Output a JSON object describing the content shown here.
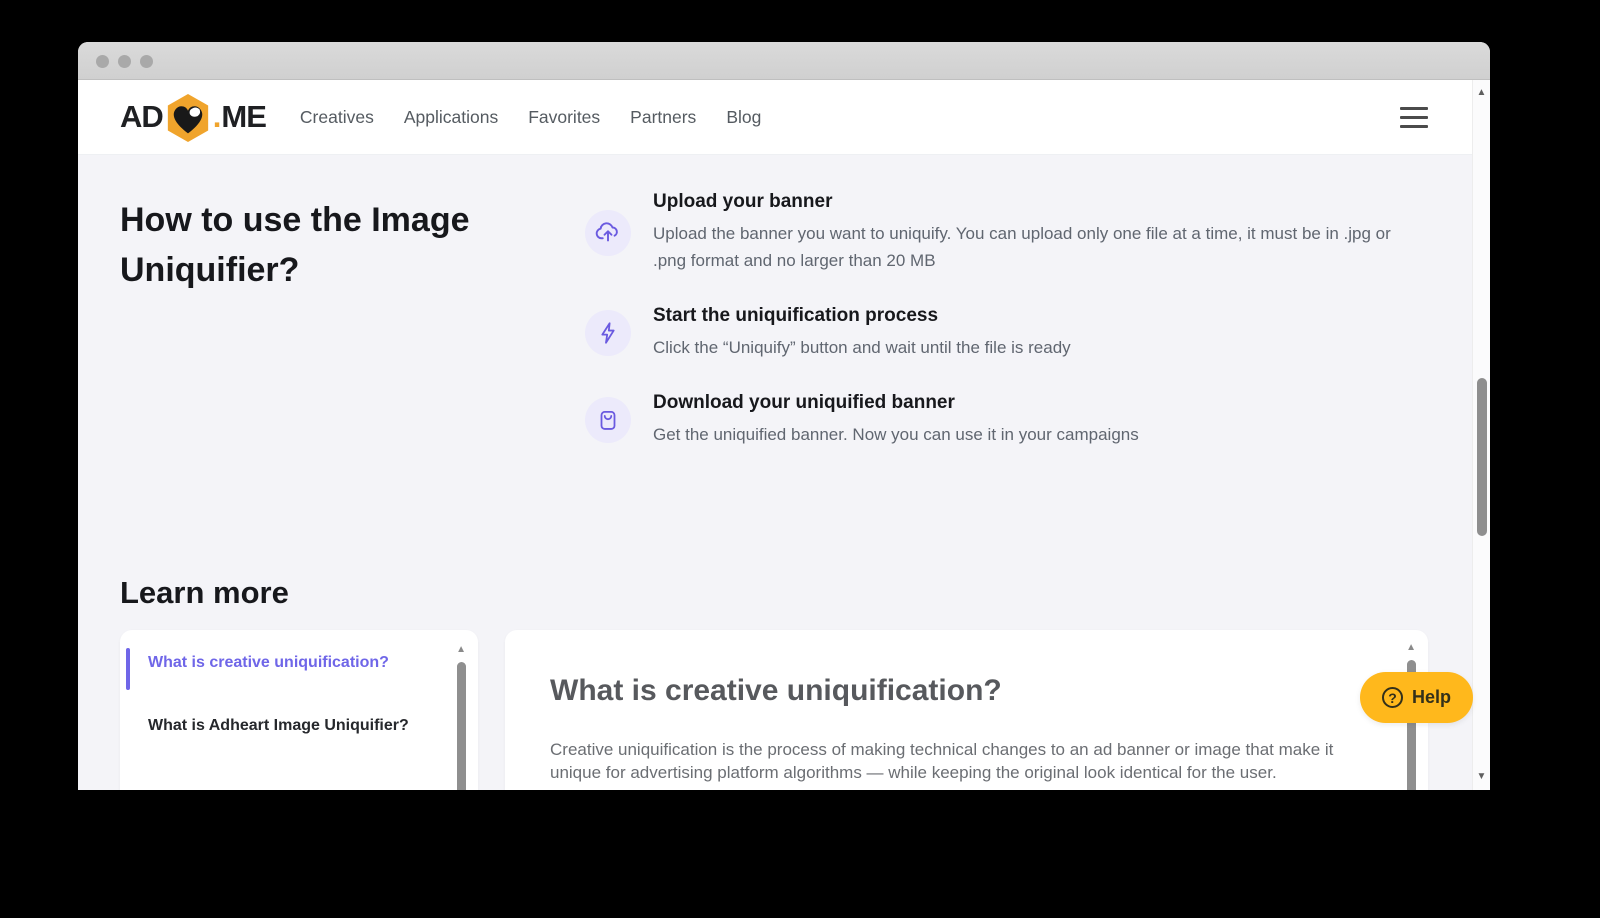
{
  "colors": {
    "accent_purple": "#6A5AE0",
    "step_icon_bg": "#ECEAFB",
    "active_link_purple": "#6F66E8",
    "logo_amber": "#F0A42C",
    "help_yellow": "#FFB81C",
    "page_bg": "#F4F4F8"
  },
  "header": {
    "logo": {
      "prefix": "AD",
      "dot": ".",
      "suffix": "ME"
    },
    "nav": [
      {
        "label": "Creatives"
      },
      {
        "label": "Applications"
      },
      {
        "label": "Favorites"
      },
      {
        "label": "Partners"
      },
      {
        "label": "Blog"
      }
    ]
  },
  "hero": {
    "title": "How to use the Image Uniquifier?",
    "steps": [
      {
        "icon": "upload-cloud-icon",
        "title": "Upload your banner",
        "description": "Upload the banner you want to uniquify. You can upload only one file at a time, it must be in .jpg or .png format and no larger than 20 MB"
      },
      {
        "icon": "lightning-icon",
        "title": "Start the uniquification process",
        "description": "Click the “Uniquify” button and wait until the file is ready"
      },
      {
        "icon": "shopping-bag-icon",
        "title": "Download your uniquified banner",
        "description": "Get the uniquified banner. Now you can use it in your campaigns"
      }
    ]
  },
  "learn_more": {
    "title": "Learn more",
    "sidebar_items": [
      {
        "label": "What is creative uniquification?",
        "active": true
      },
      {
        "label": "What is Adheart Image Uniquifier?",
        "active": false
      }
    ],
    "article": {
      "title": "What is creative uniquification?",
      "body": "Creative uniquification is the process of making technical changes to an ad banner or image that make it unique for advertising platform algorithms — while keeping the original look identical for the user."
    }
  },
  "help_button": {
    "label": "Help",
    "icon": "question-circle-icon"
  },
  "scrollbars": {
    "up_glyph": "▲",
    "down_glyph": "▼"
  }
}
